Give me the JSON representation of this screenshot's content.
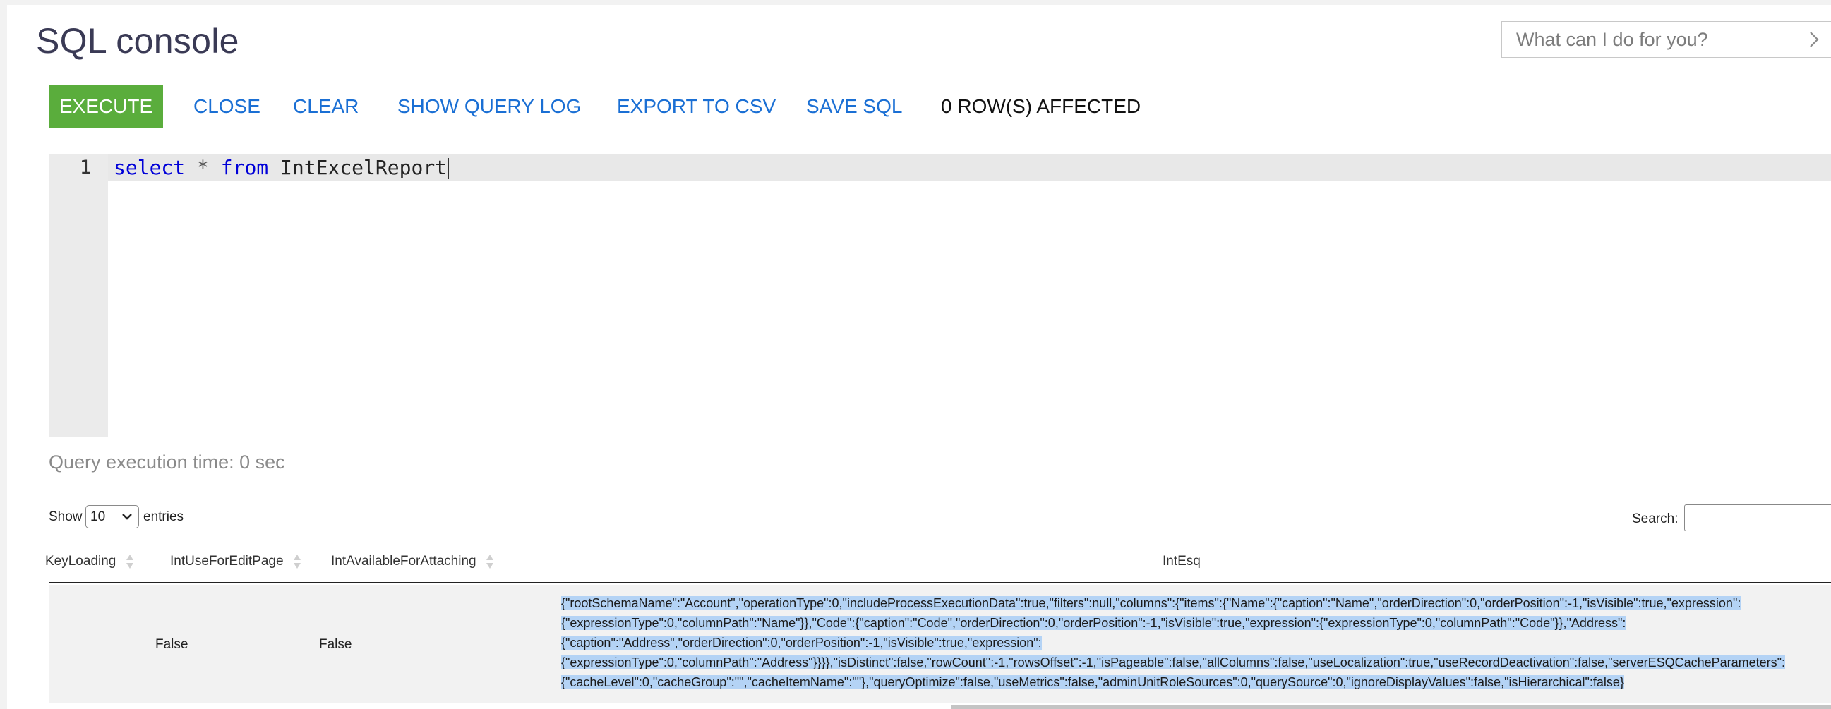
{
  "page": {
    "title": "SQL console"
  },
  "assistant": {
    "placeholder": "What can I do for you?"
  },
  "toolbar": {
    "execute": "EXECUTE",
    "close": "CLOSE",
    "clear": "CLEAR",
    "show_query_log": "SHOW QUERY LOG",
    "export_csv": "EXPORT TO CSV",
    "save_sql": "SAVE SQL",
    "status": "0 ROW(S) AFFECTED"
  },
  "editor": {
    "line_number": "1",
    "tokens": {
      "kw1": "select",
      "op": "*",
      "kw2": "from",
      "ident": "IntExcelReport"
    }
  },
  "query": {
    "exec_time": "Query execution time: 0 sec"
  },
  "grid": {
    "show_label": "Show",
    "page_size": "10",
    "entries_label": "entries",
    "search_label": "Search:",
    "columns": [
      "KeyLoading",
      "IntUseForEditPage",
      "IntAvailableForAttaching",
      "IntEsq"
    ],
    "row": {
      "IntUseForEditPage": "False",
      "IntAvailableForAttaching": "False",
      "IntEsq_lines": [
        "{\"rootSchemaName\":\"Account\",\"operationType\":0,\"includeProcessExecutionData\":true,\"filters\":null,\"columns\":{\"items\":{\"Name\":{\"caption\":\"Name\",\"orderDirection\":0,\"orderPosition\":-1,\"isVisible\":true,\"expression\":",
        "{\"expressionType\":0,\"columnPath\":\"Name\"}},\"Code\":{\"caption\":\"Code\",\"orderDirection\":0,\"orderPosition\":-1,\"isVisible\":true,\"expression\":{\"expressionType\":0,\"columnPath\":\"Code\"}},\"Address\":",
        "{\"caption\":\"Address\",\"orderDirection\":0,\"orderPosition\":-1,\"isVisible\":true,\"expression\":",
        "{\"expressionType\":0,\"columnPath\":\"Address\"}}}},\"isDistinct\":false,\"rowCount\":-1,\"rowsOffset\":-1,\"isPageable\":false,\"allColumns\":false,\"useLocalization\":true,\"useRecordDeactivation\":false,\"serverESQCacheParameters\":",
        "{\"cacheLevel\":0,\"cacheGroup\":\"\",\"cacheItemName\":\"\"},\"queryOptimize\":false,\"useMetrics\":false,\"adminUnitRoleSources\":0,\"querySource\":0,\"ignoreDisplayValues\":false,\"isHierarchical\":false}"
      ]
    }
  },
  "icons": {
    "assistant_chevron": "chevron-right-icon",
    "select_caret": "chevron-down-icon",
    "sort": "sort-icon"
  },
  "colors": {
    "execute_bg": "#5aad3c",
    "link": "#1a6fd4",
    "keyword": "#0000d8",
    "selection": "#b4d3f5"
  }
}
